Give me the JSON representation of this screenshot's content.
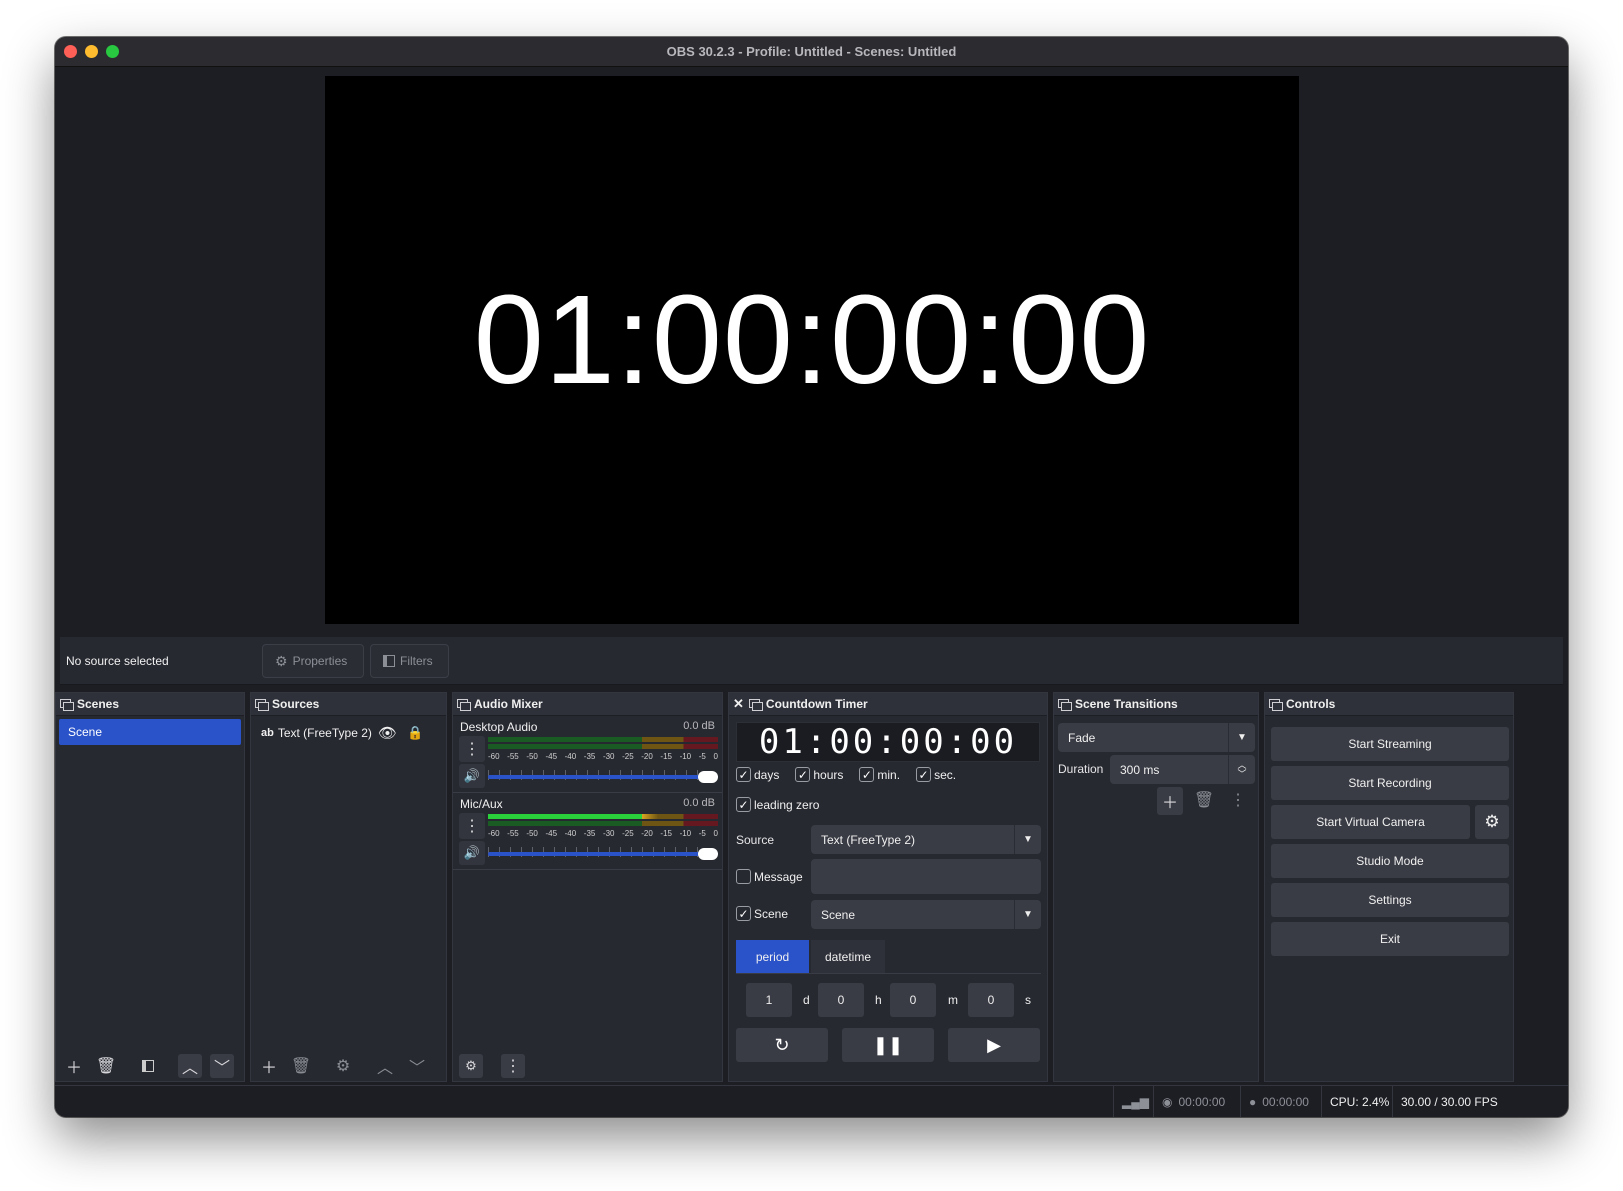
{
  "window": {
    "title": "OBS 30.2.3 - Profile: Untitled - Scenes: Untitled"
  },
  "preview": {
    "timer_text": "01:00:00:00"
  },
  "context_bar": {
    "status": "No source selected",
    "properties_label": "Properties",
    "filters_label": "Filters"
  },
  "scenes": {
    "title": "Scenes",
    "items": [
      "Scene"
    ],
    "selected": "Scene"
  },
  "sources": {
    "title": "Sources",
    "items": [
      {
        "icon": "ab",
        "label": "Text (FreeType 2)"
      }
    ]
  },
  "audio_mixer": {
    "title": "Audio Mixer",
    "channels": [
      {
        "name": "Desktop Audio",
        "db": "0.0 dB",
        "level": 1.0
      },
      {
        "name": "Mic/Aux",
        "db": "0.0 dB",
        "level": 1.0
      }
    ],
    "scale": [
      "-60",
      "-55",
      "-50",
      "-45",
      "-40",
      "-35",
      "-30",
      "-25",
      "-20",
      "-15",
      "-10",
      "-5",
      "0"
    ]
  },
  "countdown": {
    "title": "Countdown Timer",
    "display": "01:00:00:00",
    "days_label": "days",
    "hours_label": "hours",
    "min_label": "min.",
    "sec_label": "sec.",
    "leading_zero_label": "leading zero",
    "source_label": "Source",
    "source_value": "Text (FreeType 2)",
    "message_label": "Message",
    "message_value": "",
    "scene_label": "Scene",
    "scene_value": "Scene",
    "tab_period": "period",
    "tab_datetime": "datetime",
    "d_value": "1",
    "d_unit": "d",
    "h_value": "0",
    "h_unit": "h",
    "m_value": "0",
    "m_unit": "m",
    "s_value": "0",
    "s_unit": "s"
  },
  "transitions": {
    "title": "Scene Transitions",
    "selected": "Fade",
    "duration_label": "Duration",
    "duration_value": "300 ms"
  },
  "controls": {
    "title": "Controls",
    "start_streaming": "Start Streaming",
    "start_recording": "Start Recording",
    "start_virtual_camera": "Start Virtual Camera",
    "studio_mode": "Studio Mode",
    "settings": "Settings",
    "exit": "Exit"
  },
  "status": {
    "stream_time": "00:00:00",
    "record_time": "00:00:00",
    "cpu": "CPU: 2.4%",
    "fps": "30.00 / 30.00 FPS"
  },
  "colors": {
    "accent": "#2a52c9",
    "background": "#1d1e24",
    "panel": "#272931"
  }
}
